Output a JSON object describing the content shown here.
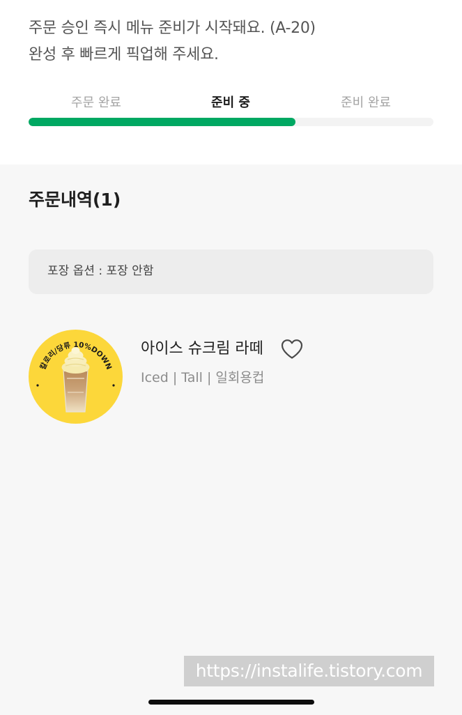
{
  "status": {
    "notice_line1": "주문 승인 즉시 메뉴 준비가 시작돼요. (A-20)",
    "notice_line2": "완성 후 빠르게 픽업해 주세요."
  },
  "progress": {
    "steps": [
      "주문 완료",
      "준비 중",
      "준비 완료"
    ],
    "active_step": 1,
    "fill_percent": 66,
    "accent_color": "#00a862"
  },
  "order": {
    "title": "주문내역(1)",
    "packaging_option": "포장 옵션 : 포장 안함",
    "items": [
      {
        "name": "아이스 슈크림 라떼",
        "options": "Iced | Tall | 일회용컵",
        "badge_text": "칼로리/당류 10%DOWN",
        "favorite_icon": "heart-outline-icon",
        "badge_color": "#fcd73a"
      }
    ]
  },
  "watermark": "https://instalife.tistory.com"
}
